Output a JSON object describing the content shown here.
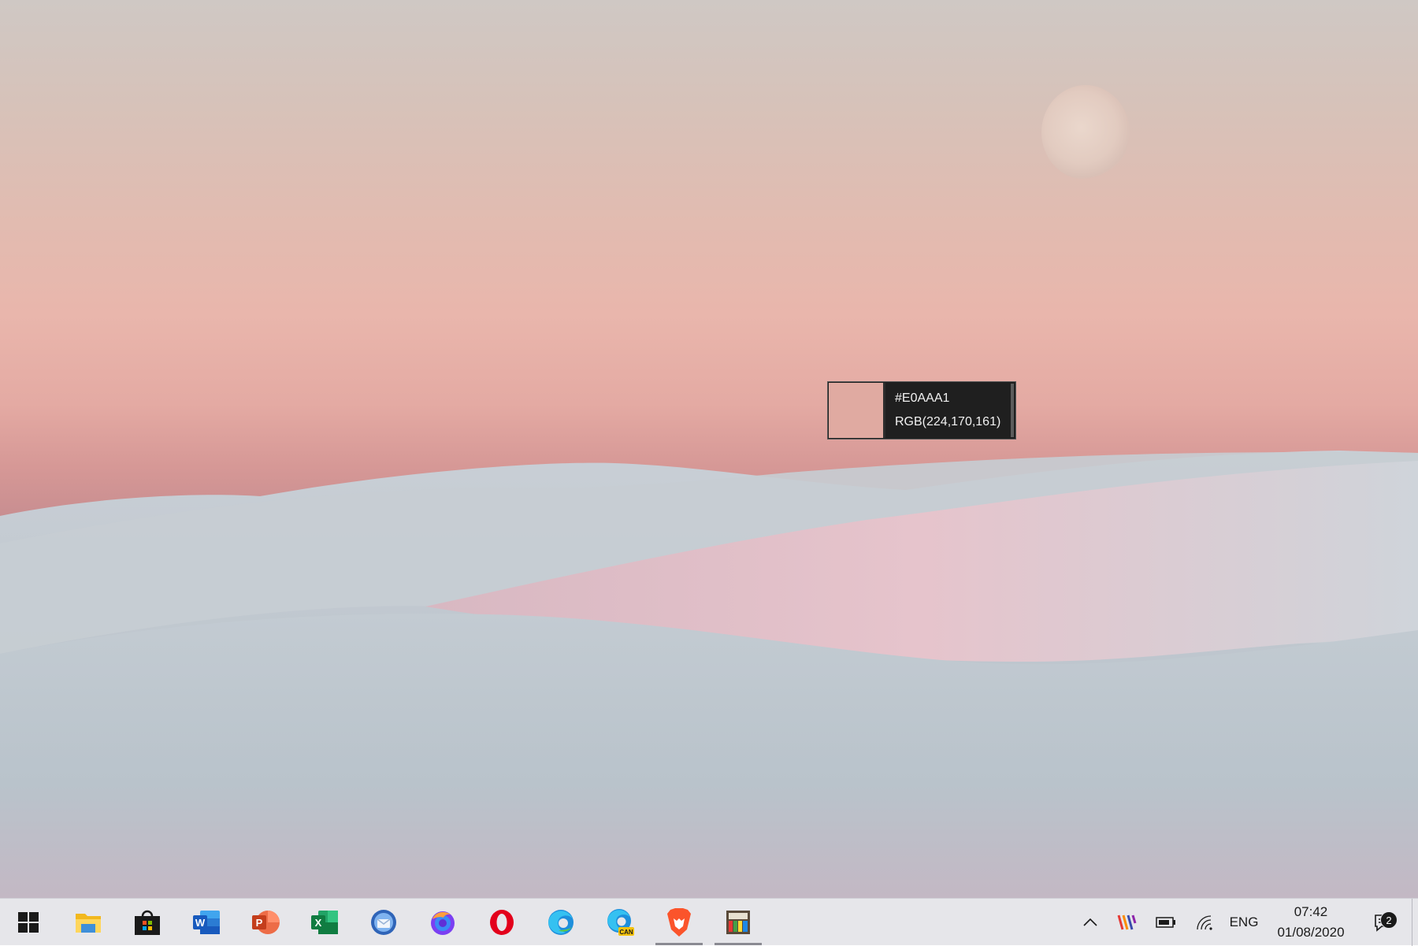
{
  "picker": {
    "hex": "#E0AAA1",
    "rgb": "RGB(224,170,161)",
    "swatch_color": "#E0AAA1"
  },
  "taskbar": {
    "apps": [
      {
        "name": "start",
        "icon": "windows-logo-icon"
      },
      {
        "name": "file-explorer",
        "icon": "folder-icon"
      },
      {
        "name": "microsoft-store",
        "icon": "store-bag-icon"
      },
      {
        "name": "word",
        "icon": "word-icon"
      },
      {
        "name": "powerpoint",
        "icon": "powerpoint-icon"
      },
      {
        "name": "excel",
        "icon": "excel-icon"
      },
      {
        "name": "thunderbird",
        "icon": "thunderbird-icon"
      },
      {
        "name": "firefox",
        "icon": "firefox-icon"
      },
      {
        "name": "opera",
        "icon": "opera-icon"
      },
      {
        "name": "edge",
        "icon": "edge-icon"
      },
      {
        "name": "edge-canary",
        "icon": "edge-canary-icon"
      },
      {
        "name": "brave",
        "icon": "brave-lion-icon"
      },
      {
        "name": "powertoys",
        "icon": "powertoys-icon"
      }
    ],
    "tray": {
      "language": "ENG",
      "time": "07:42",
      "date": "01/08/2020",
      "notification_count": "2"
    }
  }
}
